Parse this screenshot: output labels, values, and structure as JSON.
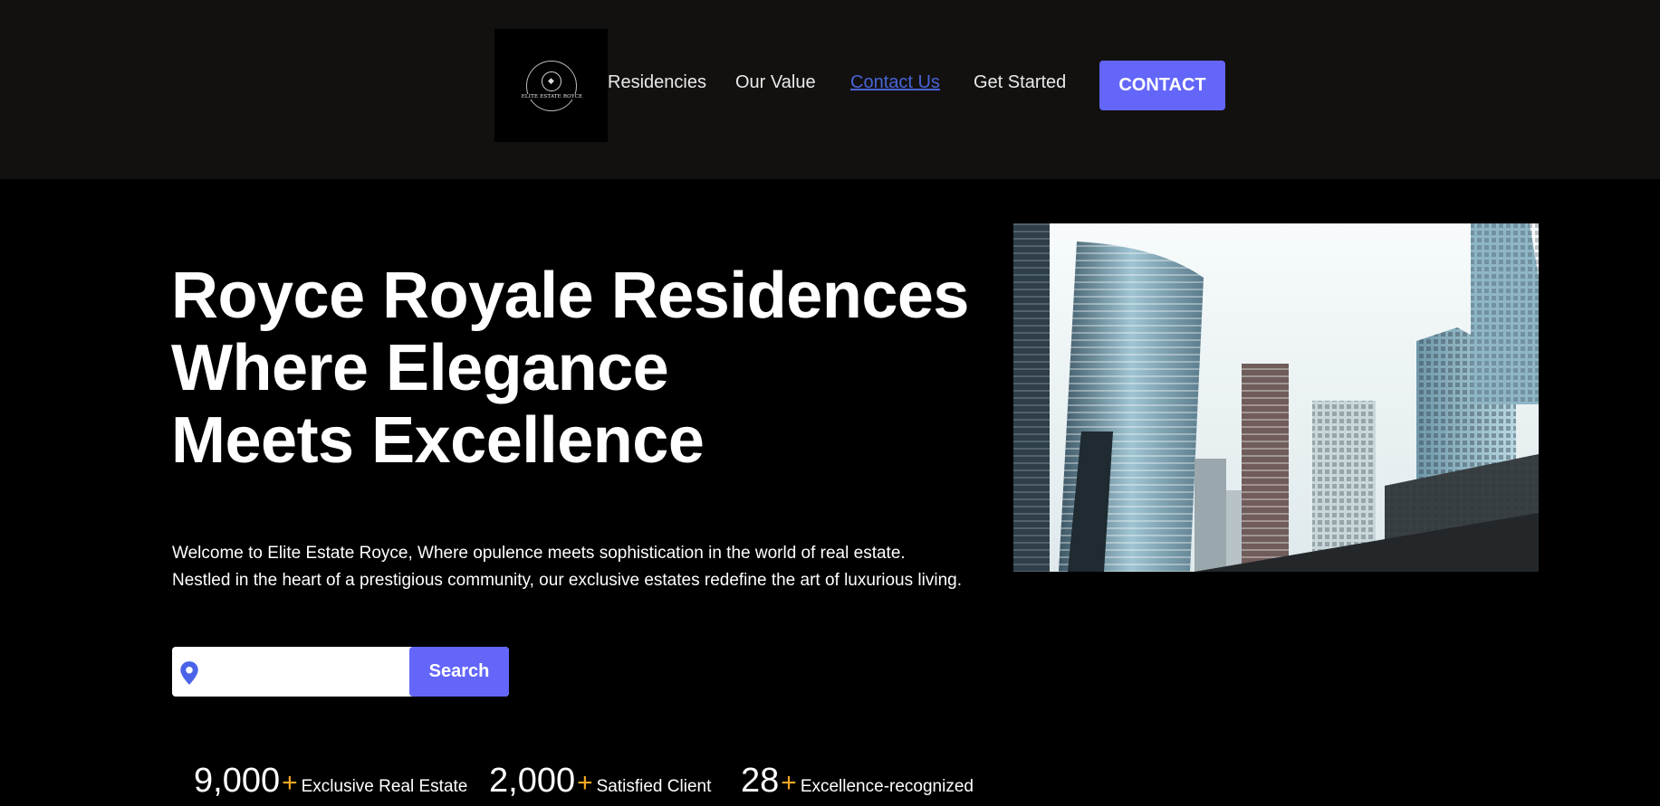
{
  "header": {
    "logo": {
      "text": "ELITE ESTATE ROYCE"
    },
    "nav": [
      {
        "label": "Residencies"
      },
      {
        "label": "Our Value"
      },
      {
        "label": "Contact Us"
      },
      {
        "label": "Get Started"
      }
    ],
    "contact_button": "CONTACT"
  },
  "hero": {
    "title_lines": [
      "Royce Royale Residences",
      "Where Elegance",
      "Meets Excellence"
    ],
    "description_lines": [
      "Welcome to Elite Estate Royce, Where opulence meets sophistication in the world of real estate.",
      "Nestled in the heart of a prestigious community, our exclusive estates redefine the art of luxurious living."
    ],
    "search": {
      "icon": "location-pin-icon",
      "value": "",
      "button_label": "Search"
    },
    "stats": [
      {
        "number": "9,000",
        "suffix": "+",
        "label": "Exclusive Real Estate"
      },
      {
        "number": "2,000",
        "suffix": "+",
        "label": "Satisfied Client"
      },
      {
        "number": "28",
        "suffix": "+",
        "label": "Excellence-recognized"
      }
    ],
    "image": "city-skyscrapers-photo"
  },
  "colors": {
    "accent": "#6366f9",
    "header_bg": "#131110",
    "page_bg": "#000000",
    "plus": "#f5a623",
    "active_link": "#4765d6"
  }
}
